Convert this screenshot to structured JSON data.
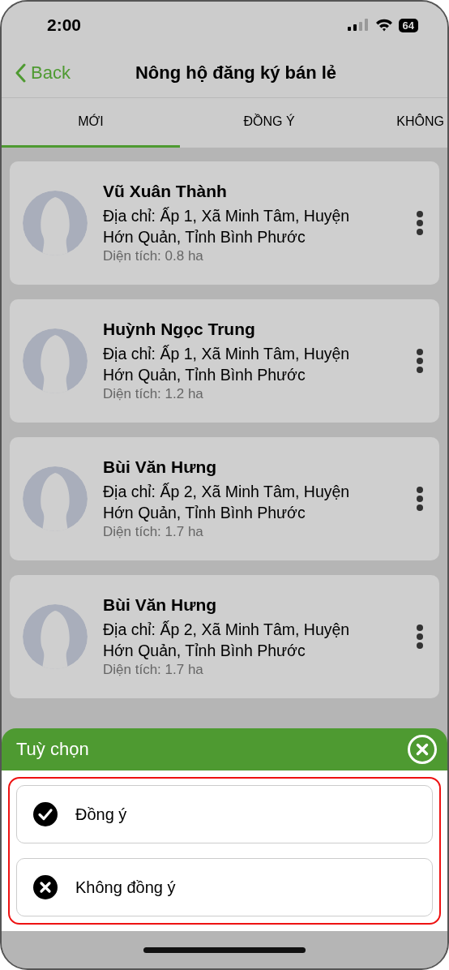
{
  "status_bar": {
    "time": "2:00",
    "battery": "64"
  },
  "nav": {
    "back": "Back",
    "title": "Nông hộ đăng ký bán lẻ"
  },
  "tabs": [
    {
      "label": "MỚI",
      "selected": true
    },
    {
      "label": "ĐỒNG Ý",
      "selected": false
    },
    {
      "label": "KHÔNG",
      "selected": false
    }
  ],
  "farmers": [
    {
      "name": "Vũ Xuân Thành",
      "address": "Địa chỉ: Ấp 1, Xã Minh Tâm, Huyện Hớn Quản, Tỉnh Bình Phước",
      "area": "Diện tích: 0.8 ha"
    },
    {
      "name": "Huỳnh Ngọc Trung",
      "address": "Địa chỉ: Ấp 1, Xã Minh Tâm, Huyện Hớn Quản, Tỉnh Bình Phước",
      "area": "Diện tích: 1.2 ha"
    },
    {
      "name": "Bùi Văn Hưng",
      "address": "Địa chỉ: Ấp 2, Xã Minh Tâm, Huyện Hớn Quản, Tỉnh Bình Phước",
      "area": "Diện tích: 1.7 ha"
    },
    {
      "name": "Bùi Văn Hưng",
      "address": "Địa chỉ: Ấp 2, Xã Minh Tâm, Huyện Hớn Quản, Tỉnh Bình Phước",
      "area": "Diện tích: 1.7 ha"
    }
  ],
  "sheet": {
    "title": "Tuỳ chọn",
    "options": [
      {
        "kind": "check",
        "label": "Đồng ý"
      },
      {
        "kind": "cross",
        "label": "Không đồng ý"
      }
    ]
  }
}
